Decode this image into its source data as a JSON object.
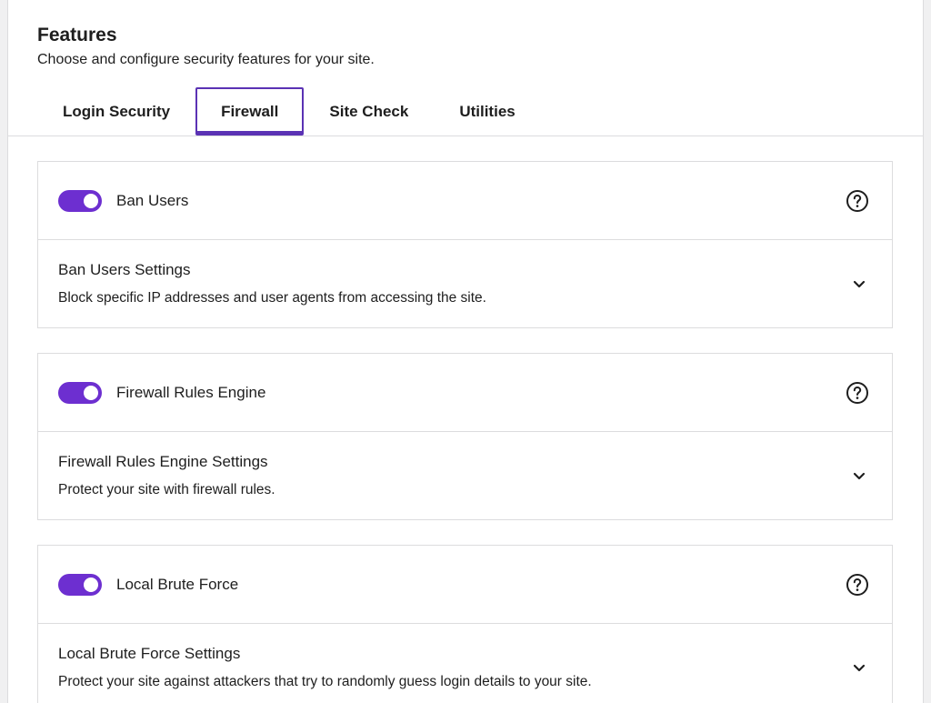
{
  "header": {
    "title": "Features",
    "subtitle": "Choose and configure security features for your site."
  },
  "tabs": [
    {
      "label": "Login Security",
      "active": false
    },
    {
      "label": "Firewall",
      "active": true
    },
    {
      "label": "Site Check",
      "active": false
    },
    {
      "label": "Utilities",
      "active": false
    }
  ],
  "features": [
    {
      "name": "Ban Users",
      "enabled": true,
      "settings_title": "Ban Users Settings",
      "settings_description": "Block specific IP addresses and user agents from accessing the site."
    },
    {
      "name": "Firewall Rules Engine",
      "enabled": true,
      "settings_title": "Firewall Rules Engine Settings",
      "settings_description": "Protect your site with firewall rules."
    },
    {
      "name": "Local Brute Force",
      "enabled": true,
      "settings_title": "Local Brute Force Settings",
      "settings_description": "Protect your site against attackers that try to randomly guess login details to your site."
    }
  ],
  "icons": {
    "help": "help-circle-icon",
    "expand": "chevron-down-icon"
  },
  "colors": {
    "accent": "#6d2fd0",
    "tab_border": "#5b32b4"
  }
}
